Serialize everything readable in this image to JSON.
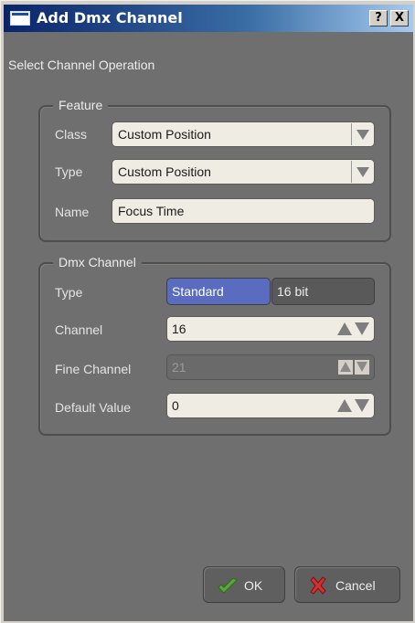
{
  "window": {
    "title": "Add Dmx Channel",
    "help_label": "?",
    "close_label": "X"
  },
  "header": "Select Channel Operation",
  "feature": {
    "title": "Feature",
    "class_label": "Class",
    "class_value": "Custom Position",
    "type_label": "Type",
    "type_value": "Custom Position",
    "name_label": "Name",
    "name_value": "Focus Time"
  },
  "dmx_channel": {
    "title": "Dmx Channel",
    "type_label": "Type",
    "type_options": [
      "Standard",
      "16 bit"
    ],
    "selected_type": "Standard",
    "channel_label": "Channel",
    "channel_value": "16",
    "fine_channel_label": "Fine Channel",
    "fine_channel_value": "21",
    "default_value_label": "Default Value",
    "default_value": "0"
  },
  "buttons": {
    "ok_label": "OK",
    "cancel_label": "Cancel"
  },
  "colors": {
    "panel": "#6f6f6f",
    "accent": "#5a6cc0",
    "titlebar": "#0a246a"
  },
  "icons": {
    "ok": "green-check-arrow-icon",
    "cancel": "red-x-icon"
  }
}
